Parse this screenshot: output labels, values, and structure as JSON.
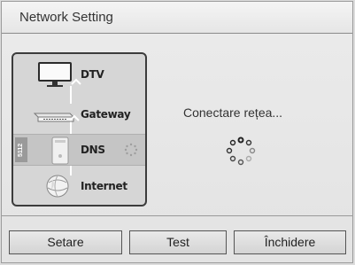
{
  "window": {
    "title": "Network Setting"
  },
  "diagram": {
    "items": [
      {
        "label": "DTV",
        "icon": "tv-icon"
      },
      {
        "label": "Gateway",
        "icon": "router-icon"
      },
      {
        "label": "DNS",
        "icon": "server-icon",
        "side_tag": "5112"
      },
      {
        "label": "Internet",
        "icon": "globe-icon"
      }
    ]
  },
  "status": {
    "text": "Conectare rețea..."
  },
  "buttons": {
    "setare": "Setare",
    "test": "Test",
    "inchidere": "Închidere"
  }
}
